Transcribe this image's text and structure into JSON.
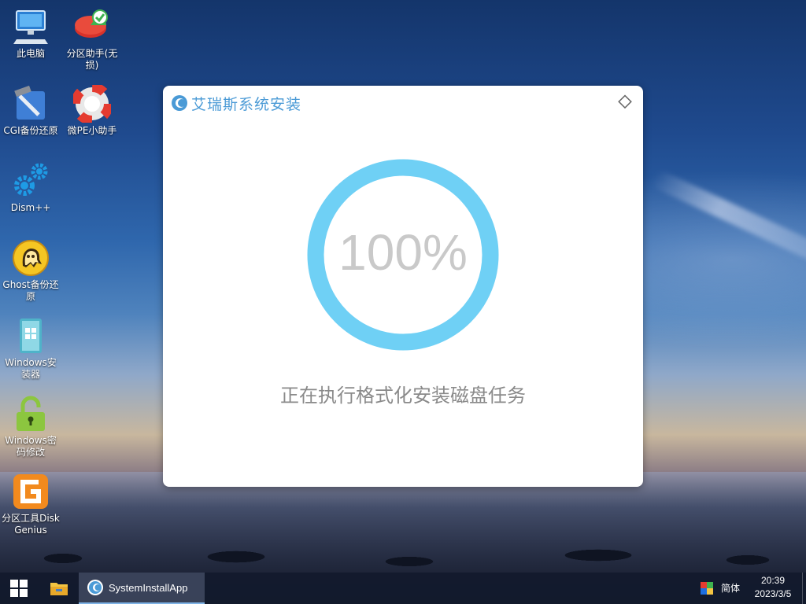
{
  "desktop": {
    "icons": [
      {
        "label": "此电脑",
        "icon": "computer-icon"
      },
      {
        "label": "分区助手(无损)",
        "icon": "partition-assistant-icon"
      },
      {
        "label": "CGI备份还原",
        "icon": "cgi-backup-icon"
      },
      {
        "label": "微PE小助手",
        "icon": "lifebuoy-icon"
      },
      {
        "label": "Dism++",
        "icon": "gears-icon"
      },
      {
        "label": "Ghost备份还原",
        "icon": "ghost-icon"
      },
      {
        "label": "Windows安装器",
        "icon": "windows-installer-icon"
      },
      {
        "label": "Windows密码修改",
        "icon": "lock-icon"
      },
      {
        "label": "分区工具DiskGenius",
        "icon": "diskgenius-icon"
      }
    ]
  },
  "installer": {
    "title": "艾瑞斯系统安装",
    "percent_text": "100%",
    "progress": 1.0,
    "status": "正在执行格式化安装磁盘任务",
    "ring_color": "#6fd0f5",
    "title_color": "#4a9ad6"
  },
  "taskbar": {
    "app_label": "SystemInstallApp",
    "ime_label": "简体",
    "time": "20:39",
    "date": "2023/3/5"
  }
}
